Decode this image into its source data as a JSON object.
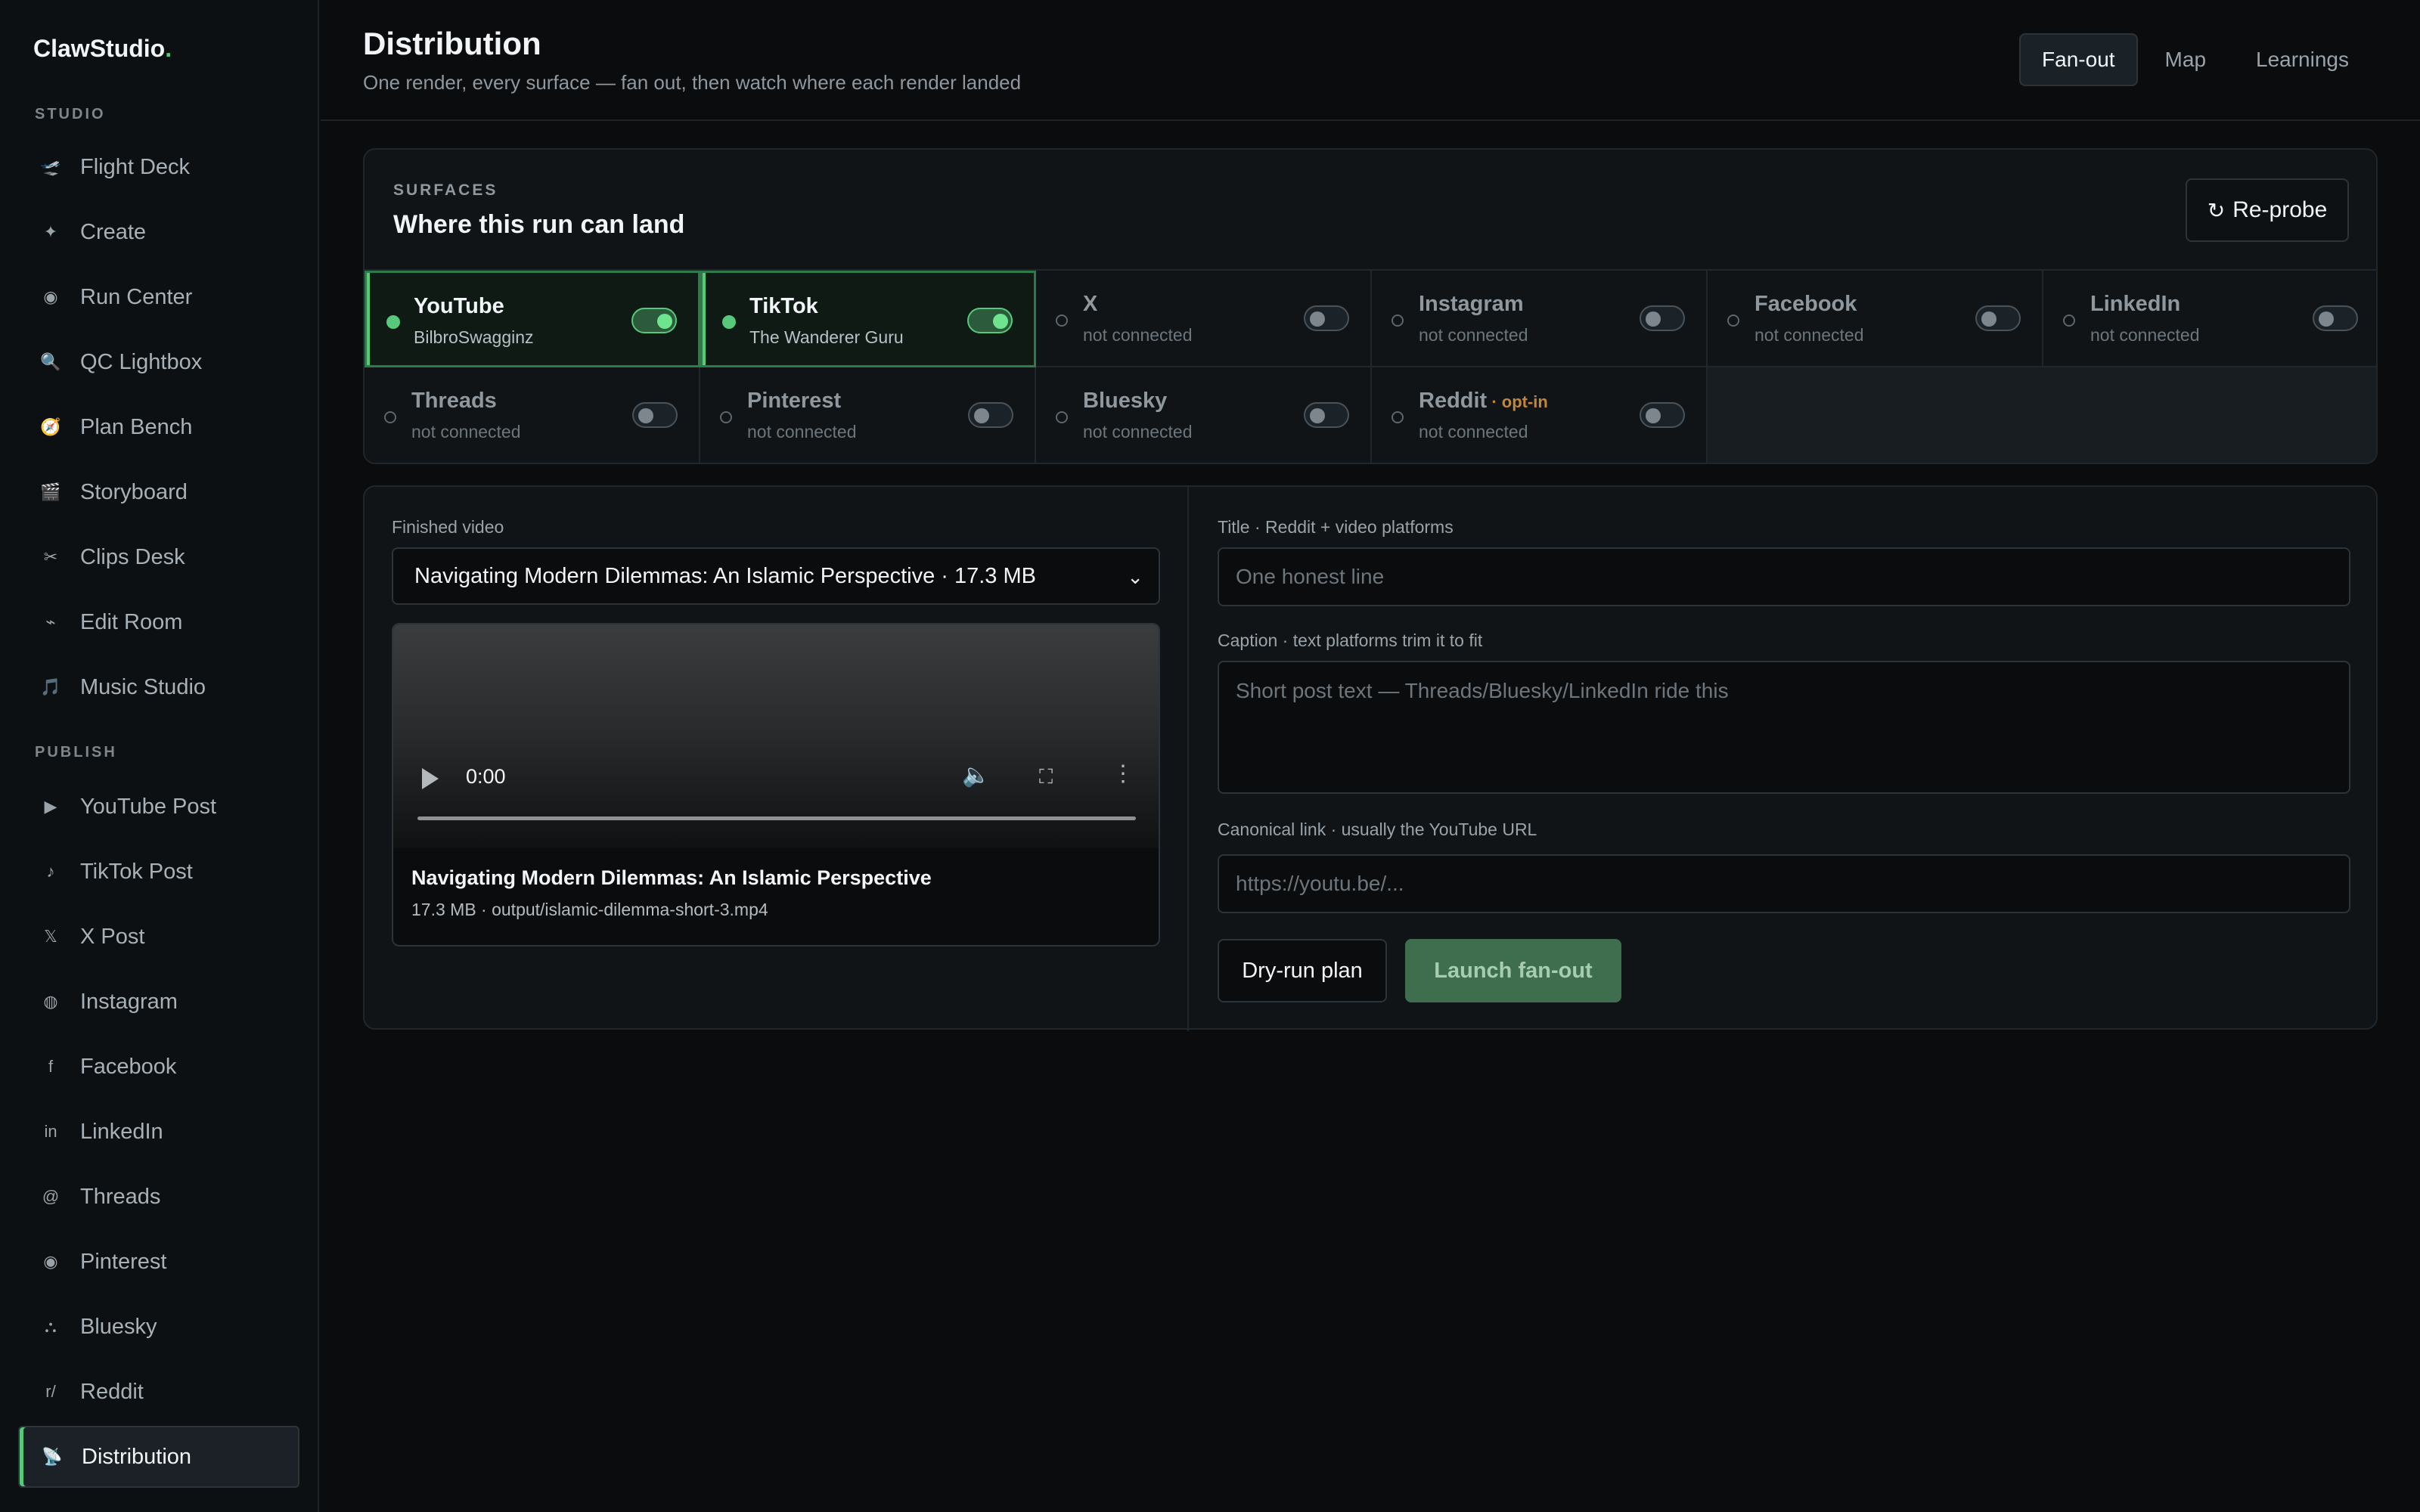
{
  "brand": {
    "name": "ClawStudio",
    "dot": "."
  },
  "sidebar": {
    "studio_label": "STUDIO",
    "publish_label": "PUBLISH",
    "studio_items": [
      {
        "label": "Flight Deck",
        "icon": "🛫"
      },
      {
        "label": "Create",
        "icon": "✦"
      },
      {
        "label": "Run Center",
        "icon": "◉"
      },
      {
        "label": "QC Lightbox",
        "icon": "🔍"
      },
      {
        "label": "Plan Bench",
        "icon": "🧭"
      },
      {
        "label": "Storyboard",
        "icon": "🎬"
      },
      {
        "label": "Clips Desk",
        "icon": "✂"
      },
      {
        "label": "Edit Room",
        "icon": "⌁"
      },
      {
        "label": "Music Studio",
        "icon": "🎵"
      }
    ],
    "publish_items": [
      {
        "label": "YouTube Post",
        "icon": "▶"
      },
      {
        "label": "TikTok Post",
        "icon": "♪"
      },
      {
        "label": "X Post",
        "icon": "𝕏"
      },
      {
        "label": "Instagram",
        "icon": "◍"
      },
      {
        "label": "Facebook",
        "icon": "f"
      },
      {
        "label": "LinkedIn",
        "icon": "in"
      },
      {
        "label": "Threads",
        "icon": "@"
      },
      {
        "label": "Pinterest",
        "icon": "◉"
      },
      {
        "label": "Bluesky",
        "icon": "⛬"
      },
      {
        "label": "Reddit",
        "icon": "r/"
      },
      {
        "label": "Distribution",
        "icon": "📡"
      }
    ]
  },
  "header": {
    "title": "Distribution",
    "subtitle": "One render, every surface — fan out, then watch where each render landed",
    "tabs": [
      "Fan-out",
      "Map",
      "Learnings"
    ],
    "active_tab": "Fan-out"
  },
  "surfaces": {
    "eyebrow": "SURFACES",
    "title": "Where this run can land",
    "reprobe_label": "Re-probe",
    "items": [
      {
        "name": "YouTube",
        "account": "BilbroSwagginz",
        "enabled": true
      },
      {
        "name": "TikTok",
        "account": "The Wanderer Guru",
        "enabled": true
      },
      {
        "name": "X",
        "account": "not connected",
        "enabled": false
      },
      {
        "name": "Instagram",
        "account": "not connected",
        "enabled": false
      },
      {
        "name": "Facebook",
        "account": "not connected",
        "enabled": false
      },
      {
        "name": "LinkedIn",
        "account": "not connected",
        "enabled": false
      },
      {
        "name": "Threads",
        "account": "not connected",
        "enabled": false
      },
      {
        "name": "Pinterest",
        "account": "not connected",
        "enabled": false
      },
      {
        "name": "Bluesky",
        "account": "not connected",
        "enabled": false
      },
      {
        "name": "Reddit",
        "badge": " · opt-in",
        "account": "not connected",
        "enabled": false
      }
    ]
  },
  "compose": {
    "video_label": "Finished video",
    "video_selected": "Navigating Modern Dilemmas: An Islamic Perspective · 17.3 MB",
    "player_time": "0:00",
    "video_title": "Navigating Modern Dilemmas: An Islamic Perspective",
    "video_meta": "17.3 MB · output/islamic-dilemma-short-3.mp4",
    "title_label": "Title · Reddit + video platforms",
    "title_placeholder": "One honest line",
    "caption_label": "Caption · text platforms trim it to fit",
    "caption_placeholder": "Short post text — Threads/Bluesky/LinkedIn ride this",
    "link_label": "Canonical link · usually the YouTube URL",
    "link_placeholder": "https://youtu.be/...",
    "dry_run_label": "Dry-run plan",
    "launch_label": "Launch fan-out"
  },
  "colors": {
    "accent": "#57c97a",
    "background": "#0a0c0e",
    "optin": "#c3853a"
  }
}
